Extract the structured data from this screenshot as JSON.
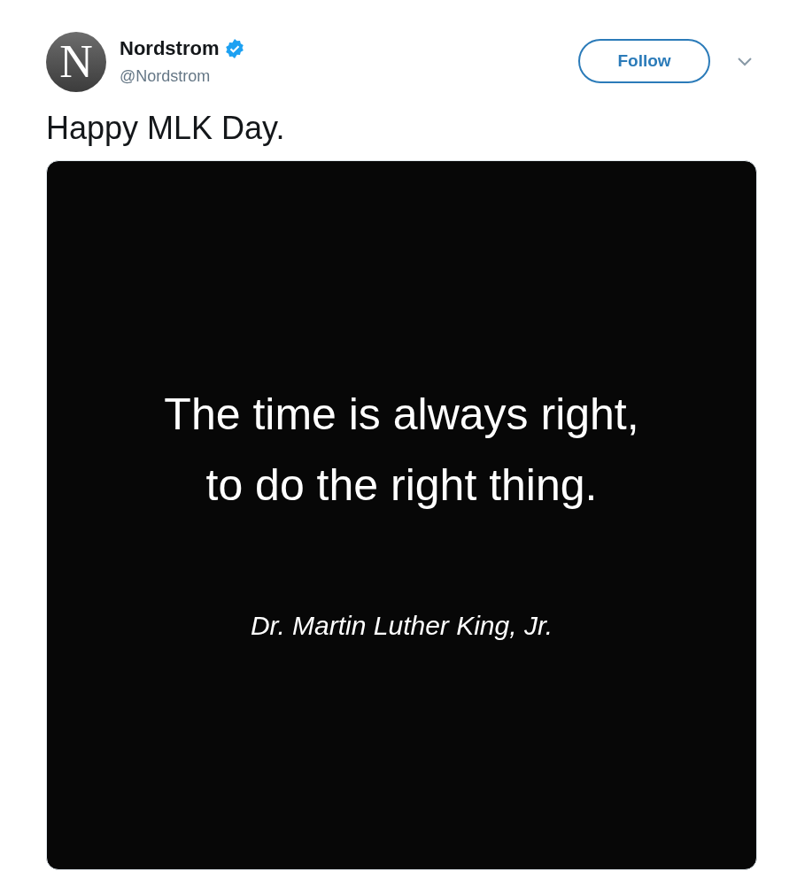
{
  "author": {
    "avatar_letter": "N",
    "name": "Nordstrom",
    "verified": true,
    "handle": "@Nordstrom"
  },
  "follow_button": {
    "label": "Follow"
  },
  "tweet_text": "Happy MLK Day.",
  "media": {
    "quote_lines": [
      "The time is always right,",
      "to do the right thing."
    ],
    "attribution": "Dr. Martin Luther King, Jr."
  }
}
